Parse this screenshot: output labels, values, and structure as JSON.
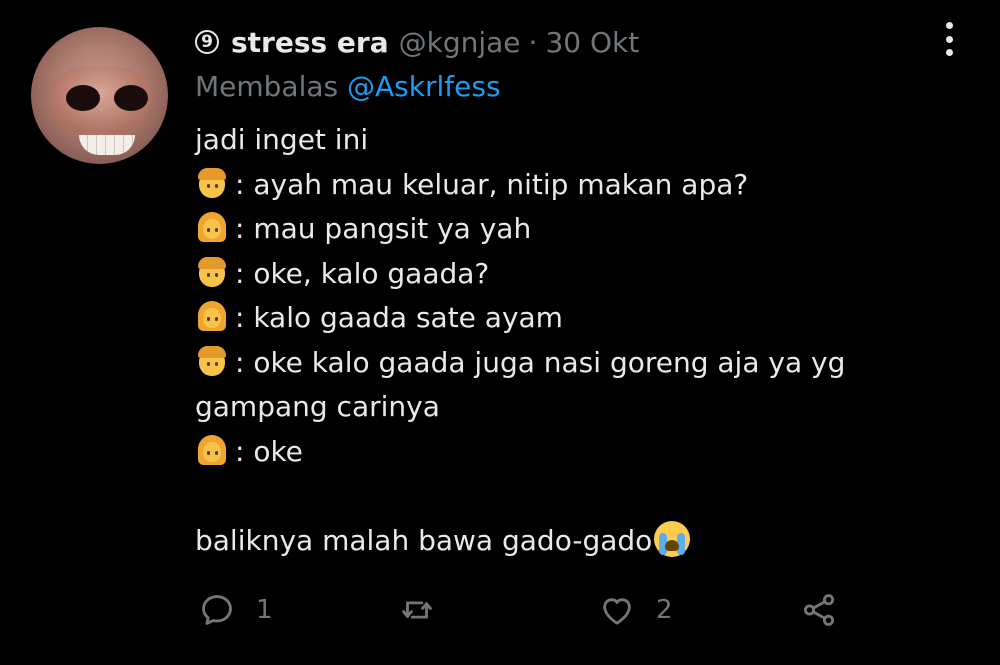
{
  "tweet": {
    "author": {
      "badge_glyph": "9",
      "name": "stress era",
      "handle": "@kgnjae",
      "separator": "·",
      "date": "30 Okt"
    },
    "replying_to": {
      "prefix": "Membalas",
      "mention": "@Askrlfess"
    },
    "body": {
      "line1": "jadi inget ini",
      "line2": ": ayah mau keluar, nitip makan apa?",
      "line3": ": mau pangsit ya yah",
      "line4": ": oke, kalo gaada?",
      "line5": ": kalo gaada sate ayam",
      "line6": ": oke kalo gaada juga nasi goreng aja ya yg",
      "line7": "gampang carinya",
      "line8": ": oke",
      "line10": "baliknya malah bawa gado-gado"
    },
    "emoji": {
      "father": "man-emoji",
      "daughter": "girl-emoji",
      "crying": "loudly-crying-face-emoji"
    },
    "actions": {
      "reply_count": "1",
      "retweet_count": "",
      "like_count": "2"
    }
  },
  "colors": {
    "background": "#000000",
    "text": "#e7e9ea",
    "muted": "#71767b",
    "link": "#1d9bf0"
  }
}
